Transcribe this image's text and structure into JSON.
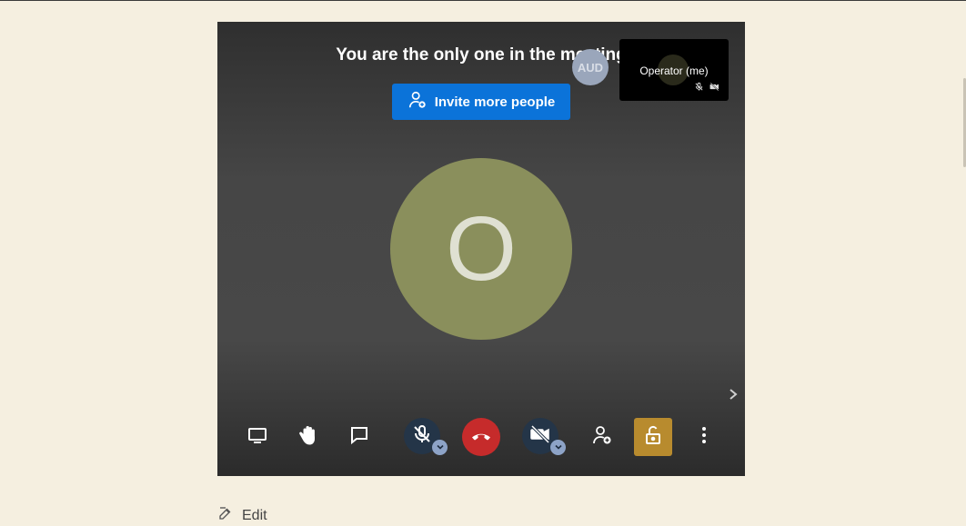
{
  "meeting": {
    "only_one_text": "You are the only one in the meeting",
    "invite_label": "Invite more people",
    "audience_avatar_initials": "AUD",
    "self_tile": {
      "name": "Operator (me)"
    },
    "main_avatar_initial": "O",
    "avatar_color": "#8a8f5c",
    "invite_color": "#0b73d9",
    "hangup_color": "#c62b2b",
    "lock_color": "#b88b2e"
  },
  "toolbar": {
    "icons": [
      "screen-share-icon",
      "raise-hand-icon",
      "chat-icon",
      "mic-muted-icon",
      "hangup-icon",
      "camera-off-icon",
      "add-participant-icon",
      "unlock-icon",
      "more-vert-icon"
    ]
  },
  "footer": {
    "edit_label": "Edit"
  }
}
